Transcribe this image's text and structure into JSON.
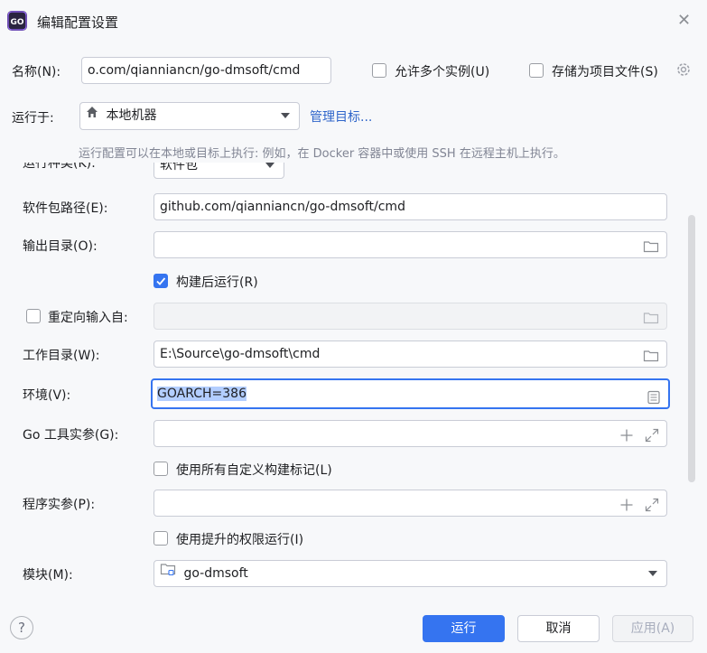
{
  "dialog": {
    "title": "编辑配置设置"
  },
  "name_row": {
    "label": "名称(N):",
    "value": "o.com/qianniancn/go-dmsoft/cmd",
    "allow_multiple_label": "允许多个实例(U)",
    "store_as_project_file_label": "存储为项目文件(S)"
  },
  "run_on": {
    "label": "运行于:",
    "target": "本地机器",
    "manage_link": "管理目标...",
    "hint": "运行配置可以在本地或目标上执行: 例如，在 Docker 容器中或使用 SSH 在远程主机上执行。"
  },
  "form": {
    "run_kind_label": "运行种类(K):",
    "run_kind_value": "软件包",
    "package_path_label": "软件包路径(E):",
    "package_path_value": "github.com/qianniancn/go-dmsoft/cmd",
    "output_dir_label": "输出目录(O):",
    "output_dir_value": "",
    "run_after_build_label": "构建后运行(R)",
    "redirect_input_label": "重定向输入自:",
    "working_dir_label": "工作目录(W):",
    "working_dir_value": "E:\\Source\\go-dmsoft\\cmd",
    "env_label": "环境(V):",
    "env_value": "GOARCH=386",
    "go_tool_args_label": "Go 工具实参(G):",
    "use_custom_tags_label": "使用所有自定义构建标记(L)",
    "program_args_label": "程序实参(P):",
    "elevated_label": "使用提升的权限运行(I)",
    "module_label": "模块(M):",
    "module_value": "go-dmsoft"
  },
  "buttons": {
    "run": "运行",
    "cancel": "取消",
    "apply": "应用(A)",
    "help": "?"
  },
  "icons": {
    "app": "goland-app-icon",
    "close": "close-icon",
    "home": "home-icon",
    "folder": "folder-icon",
    "plus": "plus-icon",
    "expand": "expand-icon",
    "gear": "gear-icon",
    "list": "list-icon",
    "module": "module-folder-icon"
  },
  "colors": {
    "accent": "#3574f0",
    "link": "#2f65ca",
    "hint": "#818594",
    "selection": "#b3ceff"
  }
}
